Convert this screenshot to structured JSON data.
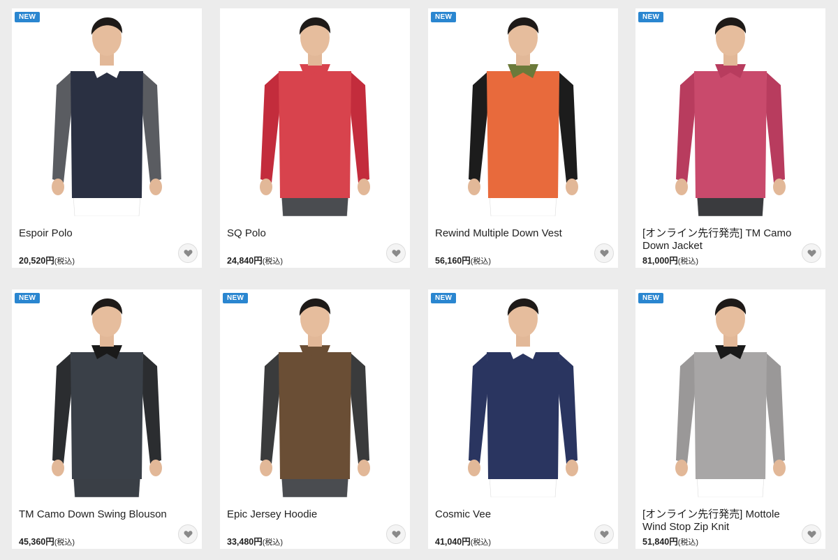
{
  "products": [
    {
      "badge": "NEW",
      "title": "Espoir Polo",
      "price": "20,520円",
      "tax": "(税込)",
      "colors": {
        "body": "#2a3042",
        "sleeve": "#5a5c61",
        "collar": "#ffffff",
        "pants": "#ffffff"
      }
    },
    {
      "badge": "",
      "title": "SQ Polo",
      "price": "24,840円",
      "tax": "(税込)",
      "colors": {
        "body": "#d8434d",
        "sleeve": "#c32c3c",
        "collar": "#d8434d",
        "pants": "#4a4c50"
      }
    },
    {
      "badge": "NEW",
      "title": "Rewind Multiple Down Vest",
      "price": "56,160円",
      "tax": "(税込)",
      "colors": {
        "body": "#e86a3c",
        "sleeve": "#1c1c1c",
        "collar": "#6b7a3a",
        "pants": "#ffffff"
      }
    },
    {
      "badge": "NEW",
      "title": "[オンライン先行発売] TM Camo Down Jacket",
      "price": "81,000円",
      "tax": "(税込)",
      "colors": {
        "body": "#c94a6c",
        "sleeve": "#b83c5e",
        "collar": "#b83c5e",
        "pants": "#3a3b3e"
      }
    },
    {
      "badge": "NEW",
      "title": "TM Camo Down Swing Blouson",
      "price": "45,360円",
      "tax": "(税込)",
      "colors": {
        "body": "#3a4048",
        "sleeve": "#2b2d30",
        "collar": "#1a1a1a",
        "pants": "#3a3f46"
      }
    },
    {
      "badge": "NEW",
      "title": "Epic Jersey Hoodie",
      "price": "33,480円",
      "tax": "(税込)",
      "colors": {
        "body": "#6a4e35",
        "sleeve": "#3a3b3c",
        "collar": "#6a4e35",
        "pants": "#4a4c50"
      }
    },
    {
      "badge": "NEW",
      "title": "Cosmic Vee",
      "price": "41,040円",
      "tax": "(税込)",
      "colors": {
        "body": "#2a3560",
        "sleeve": "#2a3560",
        "collar": "#ffffff",
        "pants": "#ffffff"
      }
    },
    {
      "badge": "NEW",
      "title": "[オンライン先行発売] Mottole Wind Stop Zip Knit",
      "price": "51,840円",
      "tax": "(税込)",
      "colors": {
        "body": "#a8a6a6",
        "sleeve": "#9a9898",
        "collar": "#1a1a1a",
        "pants": "#ffffff"
      }
    }
  ],
  "icons": {
    "favorite": "heart-icon"
  },
  "accent": {
    "badge": "#2a86d0",
    "fav_border": "#dcdcdc",
    "fav_heart": "#8a8a8a"
  }
}
